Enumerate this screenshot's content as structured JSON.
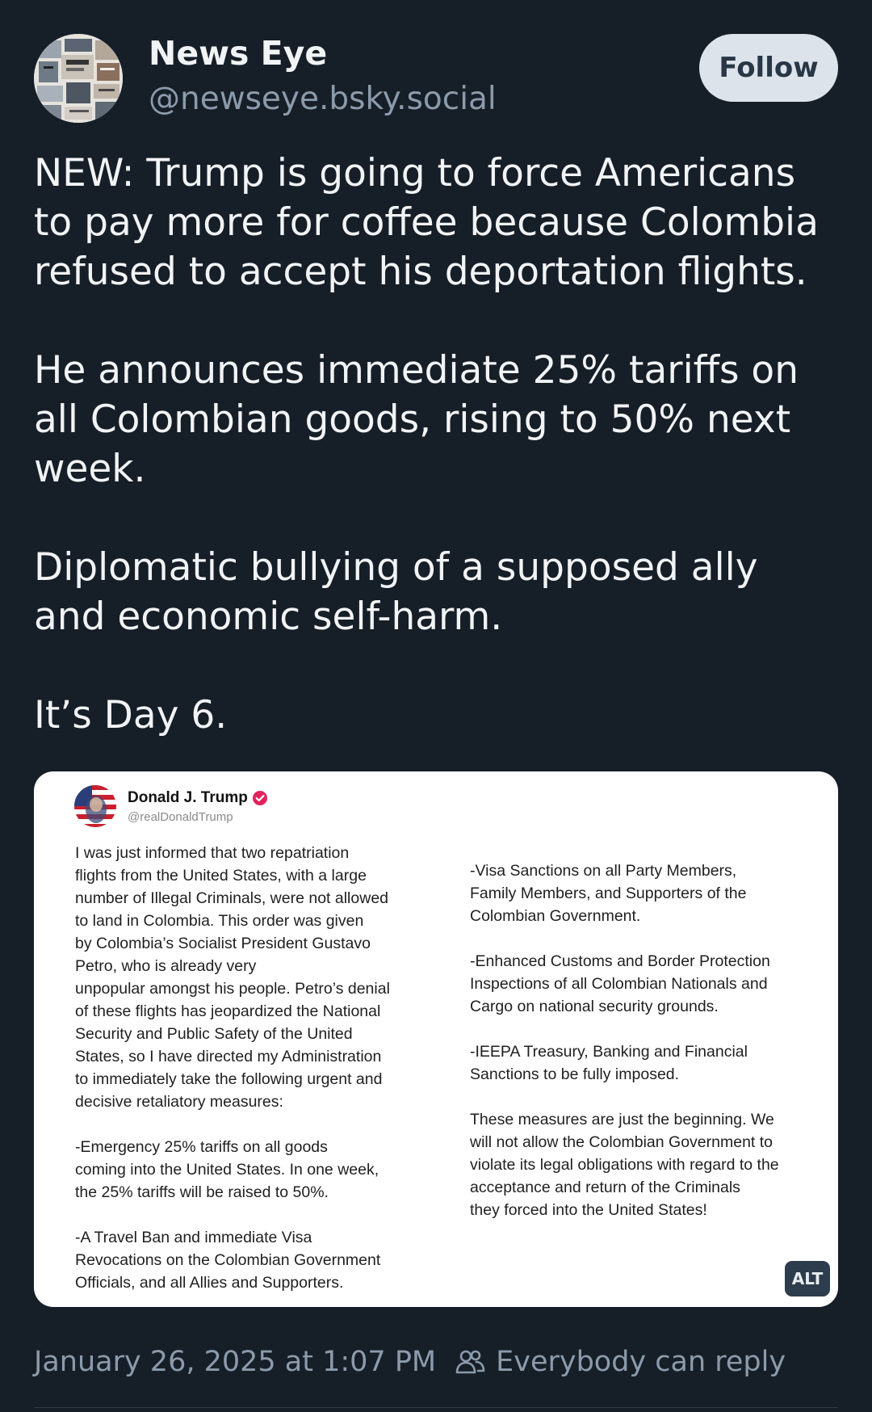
{
  "author": {
    "name": "News Eye",
    "handle": "@newseye.bsky.social",
    "avatar_icon": "newspaper-collage-avatar"
  },
  "follow_button": {
    "label": "Follow"
  },
  "post": {
    "paragraphs": [
      "NEW: Trump is going to force Americans\nto pay more for coffee because Colombia\nrefused to accept his deportation flights.",
      "He announces immediate 25% tariffs on\nall Colombian goods, rising to 50% next\nweek.",
      "Diplomatic bullying of a supposed ally\nand economic self-harm.",
      "It’s Day 6."
    ]
  },
  "embedded_image": {
    "name": "Donald J. Trump",
    "handle": "@realDonaldTrump",
    "verified_icon": "verified-badge-icon",
    "left_column": [
      "I was just informed that two repatriation\nflights from the United States, with a large\nnumber of Illegal Criminals, were not allowed\nto land in Colombia. This order was given\nby Colombia’s Socialist President Gustavo\nPetro, who is already very\nunpopular amongst his people. Petro’s denial\nof these flights has jeopardized the National\nSecurity and Public Safety of the United\nStates, so I have directed my Administration\nto immediately take the following urgent and\ndecisive retaliatory measures:",
      "-Emergency 25% tariffs on all goods\ncoming into the United States. In one week,\nthe 25% tariffs will be raised to 50%.",
      "-A Travel Ban and immediate Visa\nRevocations on the Colombian Government\nOfficials, and all Allies and Supporters."
    ],
    "right_column": [
      "-Visa Sanctions on all Party Members,\nFamily Members, and Supporters of the\nColombian Government.",
      "-Enhanced Customs and Border Protection\nInspections of all Colombian Nationals and\nCargo on national security grounds.",
      "-IEEPA Treasury, Banking and Financial\nSanctions to be fully imposed.",
      "These measures are just the beginning. We\nwill not allow the Colombian Government to\nviolate its legal obligations with regard to the\nacceptance and return of the Criminals\nthey forced into the United States!"
    ],
    "alt_label": "ALT"
  },
  "footer": {
    "timestamp": "January 26, 2025 at 1:07 PM",
    "reply_setting": "Everybody can reply",
    "reply_icon": "people-icon"
  },
  "colors": {
    "background": "#161e27",
    "text": "#f1f3f5",
    "muted": "#8c9bab",
    "follow_bg": "#dde3ea",
    "follow_text": "#283645",
    "alt_bg": "#2d3d4d"
  }
}
